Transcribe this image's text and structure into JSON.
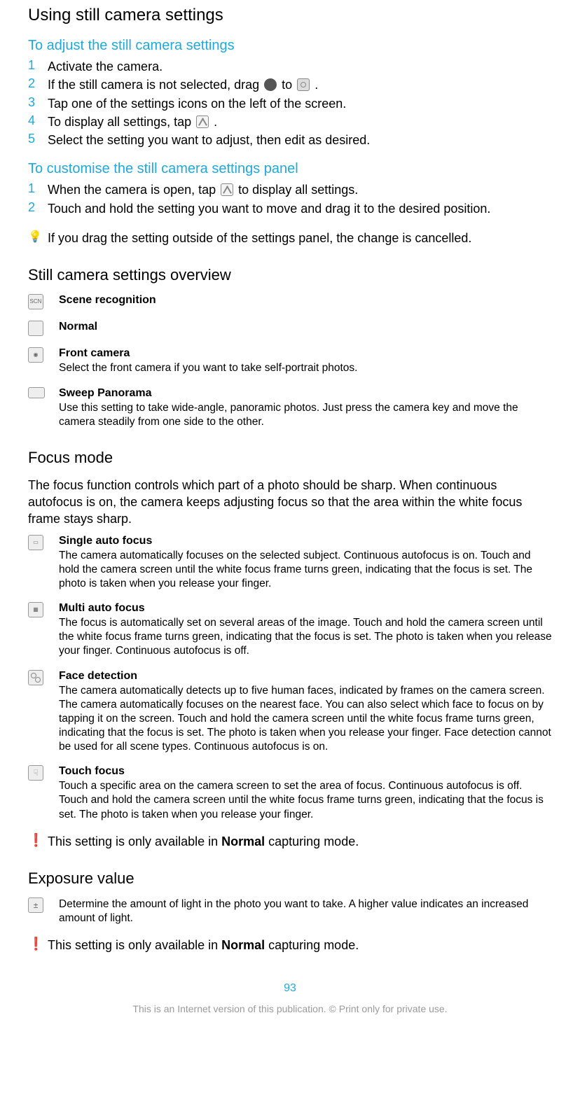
{
  "h_using": "Using still camera settings",
  "h_adjust": "To adjust the still camera settings",
  "adjust_steps": [
    {
      "n": "1",
      "t_pre": "Activate the camera."
    },
    {
      "n": "2",
      "t_pre": "If the still camera is not selected, drag ",
      "t_mid": " to ",
      "t_post": "."
    },
    {
      "n": "3",
      "t_pre": "Tap one of the settings icons on the left of the screen."
    },
    {
      "n": "4",
      "t_pre": "To display all settings, tap ",
      "t_post": "."
    },
    {
      "n": "5",
      "t_pre": "Select the setting you want to adjust, then edit as desired."
    }
  ],
  "h_customise": "To customise the still camera settings panel",
  "customise_steps": [
    {
      "n": "1",
      "t_pre": "When the camera is open, tap ",
      "t_post": " to display all settings."
    },
    {
      "n": "2",
      "t_pre": "Touch and hold the setting you want to move and drag it to the desired position."
    }
  ],
  "tip_drag": "If you drag the setting outside of the settings panel, the change is cancelled.",
  "h_overview": "Still camera settings overview",
  "overview": [
    {
      "title": "Scene recognition",
      "desc": ""
    },
    {
      "title": "Normal",
      "desc": ""
    },
    {
      "title": "Front camera",
      "desc": "Select the front camera if you want to take self-portrait photos."
    },
    {
      "title": "Sweep Panorama",
      "desc": "Use this setting to take wide-angle, panoramic photos. Just press the camera key and move the camera steadily from one side to the other."
    }
  ],
  "h_focus": "Focus mode",
  "focus_intro": "The focus function controls which part of a photo should be sharp. When continuous autofocus is on, the camera keeps adjusting focus so that the area within the white focus frame stays sharp.",
  "focus_items": [
    {
      "title": "Single auto focus",
      "desc": "The camera automatically focuses on the selected subject. Continuous autofocus is on. Touch and hold the camera screen until the white focus frame turns green, indicating that the focus is set. The photo is taken when you release your finger."
    },
    {
      "title": "Multi auto focus",
      "desc": "The focus is automatically set on several areas of the image. Touch and hold the camera screen until the white focus frame turns green, indicating that the focus is set. The photo is taken when you release your finger. Continuous autofocus is off."
    },
    {
      "title": "Face detection",
      "desc": "The camera automatically detects up to five human faces, indicated by frames on the camera screen. The camera automatically focuses on the nearest face. You can also select which face to focus on by tapping it on the screen. Touch and hold the camera screen until the white focus frame turns green, indicating that the focus is set. The photo is taken when you release your finger. Face detection cannot be used for all scene types. Continuous autofocus is on."
    },
    {
      "title": "Touch focus",
      "desc": "Touch a specific area on the camera screen to set the area of focus. Continuous autofocus is off. Touch and hold the camera screen until the white focus frame turns green, indicating that the focus is set. The photo is taken when you release your finger."
    }
  ],
  "note_normal_pre": "This setting is only available in ",
  "note_normal_b": "Normal",
  "note_normal_post": " capturing mode.",
  "h_exposure": "Exposure value",
  "exposure_desc": "Determine the amount of light in the photo you want to take. A higher value indicates an increased amount of light.",
  "page_num": "93",
  "footer": "This is an Internet version of this publication. © Print only for private use."
}
